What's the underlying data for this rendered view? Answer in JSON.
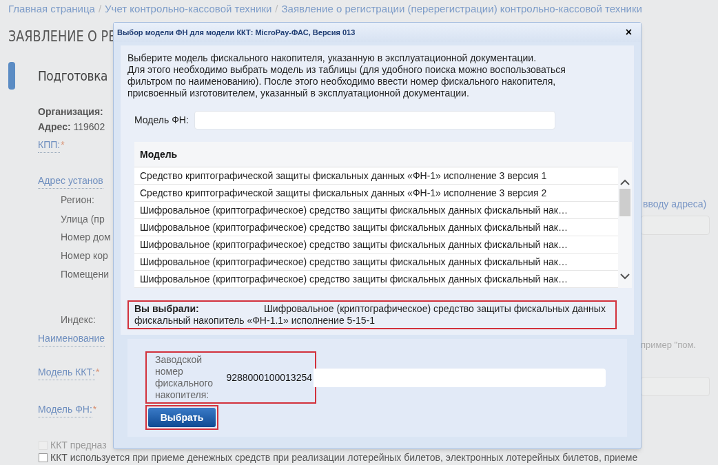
{
  "breadcrumbs": [
    "Главная страница",
    "Учет контрольно-кассовой техники",
    "Заявление о регистрации (перерегистрации) контрольно-кассовой техники"
  ],
  "breadcrumb_separator": "/",
  "page_title": "ЗАЯВЛЕНИЕ О РЕ",
  "left_items": [
    {
      "kind": "heading",
      "text": "Подготовка"
    },
    {
      "kind": "bold",
      "text": "Организация:"
    },
    {
      "kind": "address",
      "label": "Адрес:",
      "text": "119602"
    },
    {
      "kind": "link",
      "text": "КПП:",
      "mark": "*"
    },
    {
      "kind": "link",
      "text": "Адрес установ"
    },
    {
      "kind": "sublabel",
      "text": "Регион:"
    },
    {
      "kind": "sublabel",
      "text": "Улица (пр"
    },
    {
      "kind": "sublabel",
      "text": "Номер дом"
    },
    {
      "kind": "sublabel",
      "text": "Номер кор"
    },
    {
      "kind": "sublabel",
      "text": "Помещени"
    },
    {
      "kind": "sublabel",
      "text": "Индекс:"
    },
    {
      "kind": "link",
      "text": "Наименование"
    },
    {
      "kind": "link",
      "text": "Модель ККТ:",
      "mark": "*"
    },
    {
      "kind": "link",
      "text": "Модель ФН:",
      "mark": "*"
    },
    {
      "kind": "checkbox",
      "text": "ККТ предназ",
      "checked": false,
      "disabled": true
    }
  ],
  "right_items": [
    {
      "kind": "link",
      "text": "вводу адреса)"
    },
    {
      "kind": "field"
    },
    {
      "kind": "hint",
      "text": "пример \"пом."
    },
    {
      "kind": "field"
    }
  ],
  "bottom_checkbox": {
    "text": "ККТ используется при приеме денежных средств при реализации лотерейных билетов, электронных лотерейных билетов, приеме",
    "checked": false,
    "disabled": false
  },
  "dialog": {
    "title": "Выбор модели ФН для модели ККТ: MicroPay-ФАС, Версия 013",
    "close": "×",
    "instructions": [
      "Выберите модель фискального накопителя, указанную в эксплуатационной документации.",
      "Для этого необходимо выбрать модель из таблицы (для удобного поиска можно воспользоваться фильтром по наименованию). После этого необходимо ввести номер фискального накопителя, присвоенный изготовителем, указанный в эксплуатационной документации."
    ],
    "filter": {
      "label": "Модель ФН:"
    },
    "table": {
      "columns": [
        "Модель"
      ],
      "rows": [
        "Средство криптографической защиты фискальных данных «ФН-1» исполнение 3 версия 1",
        "Средство криптографической защиты фискальных данных «ФН-1» исполнение 3 версия 2",
        "Шифровальное (криптографическое) средство защиты фискальных данных фискальный нак…",
        "Шифровальное (криптографическое) средство защиты фискальных данных фискальный нак…",
        "Шифровальное (криптографическое) средство защиты фискальных данных фискальный нак…",
        "Шифровальное (криптографическое) средство защиты фискальных данных фискальный нак…",
        "Шифровальное (криптографическое) средство защиты фискальных данных фискальный нак…"
      ]
    },
    "selection": {
      "label": "Вы выбрали:",
      "value": "Шифровальное (криптографическое) средство защиты фискальных данных фискальный накопитель «ФН-1.1» исполнение 5-15-1"
    },
    "serial": {
      "label": "Заводской номер фискального накопителя:",
      "value": "9288000100013254"
    },
    "button": "Выбрать"
  }
}
